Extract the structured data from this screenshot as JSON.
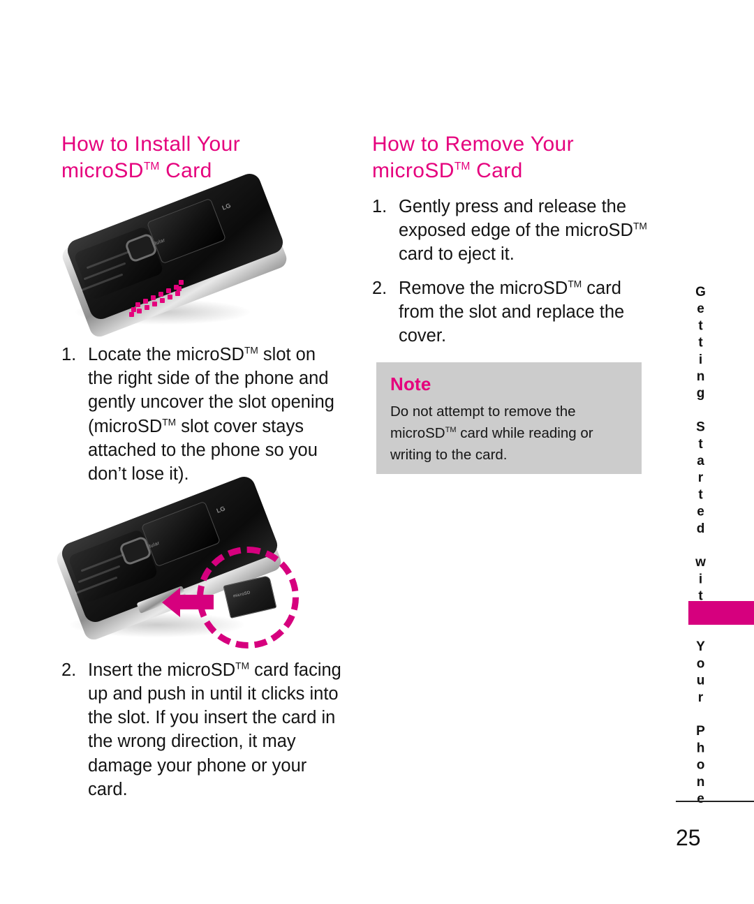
{
  "page": {
    "number": "25",
    "side_tab_label": "Getting Started with Your Phone",
    "accent_color": "#E5007D",
    "tab_color": "#D6007E",
    "note_bg_color": "#cccccc"
  },
  "install_section": {
    "heading_line1": "How to Install Your",
    "heading_line2_prefix": "microSD",
    "heading_tm": "TM",
    "heading_line2_suffix": " Card",
    "figure_top_alt": "Phone shown at an angle with magenta dotted outline marking the microSD slot on the right side",
    "figure_bottom_alt": "Phone with slot cover open, magenta arrow pointing left and dashed magenta circle around the microSD card",
    "steps": [
      {
        "number": "1.",
        "parts": [
          {
            "t": "Locate the microSD"
          },
          {
            "tm": "TM"
          },
          {
            "t": " slot on the right side of the phone and gently uncover the slot opening (microSD"
          },
          {
            "tm": "TM"
          },
          {
            "t": " slot cover stays attached to the phone so you don’t lose it)."
          }
        ]
      },
      {
        "number": "2.",
        "parts": [
          {
            "t": "Insert the microSD"
          },
          {
            "tm": "TM"
          },
          {
            "t": " card facing up and push in until it clicks into the slot. If you insert the card in the wrong direction, it may damage your phone or your card."
          }
        ]
      }
    ]
  },
  "remove_section": {
    "heading_line1": "How to Remove Your",
    "heading_line2_prefix": "microSD",
    "heading_tm": "TM",
    "heading_line2_suffix": " Card",
    "steps": [
      {
        "number": "1.",
        "parts": [
          {
            "t": "Gently press and release the exposed edge of the microSD"
          },
          {
            "tm": "TM"
          },
          {
            "t": " card to eject it."
          }
        ]
      },
      {
        "number": "2.",
        "parts": [
          {
            "t": "Remove the microSD"
          },
          {
            "tm": "TM"
          },
          {
            "t": " card from the slot and replace the cover."
          }
        ]
      }
    ]
  },
  "note": {
    "title": "Note",
    "parts": [
      {
        "t": "Do not attempt to remove the microSD"
      },
      {
        "tm": "TM"
      },
      {
        "t": " card while reading or writing to the card."
      }
    ]
  },
  "phone_graphic": {
    "brand_text": "cellular",
    "logo_text": "LG",
    "sd_card_text": "microSD"
  }
}
